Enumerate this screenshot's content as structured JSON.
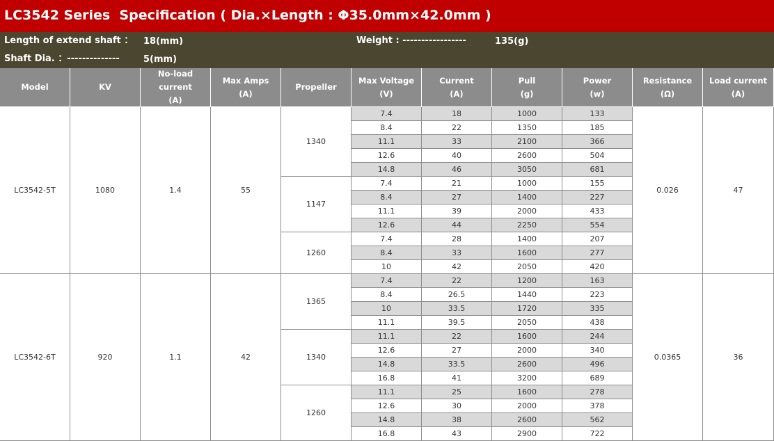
{
  "title": "LC3542 Series  Specification ( Dia.×Length : Φ35.0mm×42.0mm )",
  "specs": {
    "extend_label": "Length of extend shaft ：",
    "extend_value": "18(mm)",
    "weight_label": "Weight : -----------------",
    "weight_value": "135(g)",
    "shaft_label": "Shaft Dia. ：--------------",
    "shaft_value": "5(mm)"
  },
  "headers": [
    {
      "line1": "Model",
      "line2": ""
    },
    {
      "line1": "KV",
      "line2": ""
    },
    {
      "line1": "No-load",
      "line2": "current",
      "line3": "(A)"
    },
    {
      "line1": "Max Amps",
      "line2": "(A)"
    },
    {
      "line1": "Propeller",
      "line2": ""
    },
    {
      "line1": "Max Voltage",
      "line2": "(V)"
    },
    {
      "line1": "Current",
      "line2": "(A)"
    },
    {
      "line1": "Pull",
      "line2": "(g)"
    },
    {
      "line1": "Power",
      "line2": "(w)"
    },
    {
      "line1": "Resistance",
      "line2": "(Ω)"
    },
    {
      "line1": "Load current",
      "line2": "(A)"
    }
  ],
  "models": [
    {
      "model": "LC3542-5T",
      "kv": "1080",
      "noload": "1.4",
      "maxamps": "55",
      "resistance": "0.026",
      "load_current": "47",
      "propellers": [
        {
          "name": "1340",
          "rows": [
            [
              "7.4",
              "18",
              "1000",
              "133"
            ],
            [
              "8.4",
              "22",
              "1350",
              "185"
            ],
            [
              "11.1",
              "33",
              "2100",
              "366"
            ],
            [
              "12.6",
              "40",
              "2600",
              "504"
            ],
            [
              "14.8",
              "46",
              "3050",
              "681"
            ]
          ]
        },
        {
          "name": "1147",
          "rows": [
            [
              "7.4",
              "21",
              "1000",
              "155"
            ],
            [
              "8.4",
              "27",
              "1400",
              "227"
            ],
            [
              "11.1",
              "39",
              "2000",
              "433"
            ],
            [
              "12.6",
              "44",
              "2250",
              "554"
            ]
          ]
        },
        {
          "name": "1260",
          "rows": [
            [
              "7.4",
              "28",
              "1400",
              "207"
            ],
            [
              "8.4",
              "33",
              "1600",
              "277"
            ],
            [
              "10",
              "42",
              "2050",
              "420"
            ]
          ]
        }
      ]
    },
    {
      "model": "LC3542-6T",
      "kv": "920",
      "noload": "1.1",
      "maxamps": "42",
      "resistance": "0.0365",
      "load_current": "36",
      "propellers": [
        {
          "name": "1365",
          "rows": [
            [
              "7.4",
              "22",
              "1200",
              "163"
            ],
            [
              "8.4",
              "26.5",
              "1440",
              "223"
            ],
            [
              "10",
              "33.5",
              "1720",
              "335"
            ],
            [
              "11.1",
              "39.5",
              "2050",
              "438"
            ]
          ]
        },
        {
          "name": "1340",
          "rows": [
            [
              "11.1",
              "22",
              "1600",
              "244"
            ],
            [
              "12.6",
              "27",
              "2000",
              "340"
            ],
            [
              "14.8",
              "33.5",
              "2600",
              "496"
            ],
            [
              "16.8",
              "41",
              "3200",
              "689"
            ]
          ]
        },
        {
          "name": "1260",
          "rows": [
            [
              "11.1",
              "25",
              "1600",
              "278"
            ],
            [
              "12.6",
              "30",
              "2000",
              "378"
            ],
            [
              "14.8",
              "38",
              "2600",
              "562"
            ],
            [
              "16.8",
              "43",
              "2900",
              "722"
            ]
          ]
        }
      ]
    }
  ]
}
